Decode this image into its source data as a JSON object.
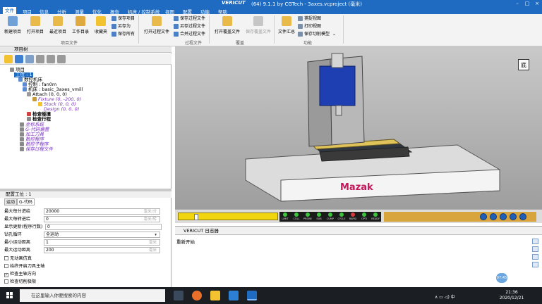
{
  "window": {
    "app_name": "VERICUT",
    "title_suffix": "(64)  9.1.1 by CGTech - 3axes.vcproject (毫米)"
  },
  "menu": [
    "文件",
    "项目",
    "信息",
    "分析",
    "测量",
    "优化",
    "报告",
    "机床 / 控制系统",
    "视图",
    "配置",
    "功能",
    "帮助"
  ],
  "ribbon": {
    "project_file": {
      "buttons": [
        "新建项目",
        "打开项目",
        "最近项目",
        "工作目录",
        "收藏夹"
      ],
      "small": [
        "保存项目",
        "另存为",
        "保存所有"
      ],
      "group": "项目文件"
    },
    "process_file": {
      "button": "打开过程文件",
      "small": [
        "保存过程文件",
        "另存过程文件",
        "合并过程文件"
      ],
      "group": "过程文件"
    },
    "overlay": {
      "buttons": [
        "打开覆盖文件",
        "保存覆盖文件"
      ],
      "group": "覆盖"
    },
    "functions": {
      "button": "文件汇总",
      "small": [
        "捕捉视图",
        "打印视图",
        "保存切削模型"
      ],
      "group": "功能"
    }
  },
  "tree": {
    "title": "项目树",
    "items": [
      "项目",
      "工位 : 1",
      "数控机床",
      "控制 : fan0m",
      "机床 : basic_3axes_vmill",
      "Attach (0, 0, 0)",
      "Fixture (0, -200, 0)",
      "Stock (0, 0, 0)",
      "Design (0, 0, 0)",
      "检查碰撞",
      "检查行程",
      "坐标系统",
      "G-代码偏置",
      "加工刀具",
      "数控程序",
      "数控子程序",
      "保存过程文件"
    ]
  },
  "config": {
    "title": "配置工位 : 1",
    "tabs": [
      "运动",
      "G-代码"
    ],
    "rows": [
      {
        "label": "最大每分进给",
        "value": "20000",
        "unit": "毫米/分"
      },
      {
        "label": "最大每转进给",
        "value": "0",
        "unit": "毫米/转"
      },
      {
        "label": "显示更新(程序行数)",
        "value": "0",
        "unit": ""
      },
      {
        "label": "钻孔循环",
        "value": "全运动",
        "unit": ""
      },
      {
        "label": "最小运动距离",
        "value": "1",
        "unit": "毫米"
      },
      {
        "label": "最大运动距离",
        "value": "200",
        "unit": "毫米"
      }
    ],
    "checks": [
      {
        "label": "无动画仿真",
        "checked": false
      },
      {
        "label": "始终开启刀具主轴",
        "checked": false
      },
      {
        "label": "检查主轴方向",
        "checked": true
      },
      {
        "label": "检查切削极限",
        "checked": false
      }
    ]
  },
  "viewport": {
    "brand": "Mazak",
    "view_cube": "底"
  },
  "status_leds": [
    "LIMIT",
    "COLL",
    "PROBE",
    "SUB",
    "CUMP",
    "CYCLE",
    "RAPID",
    "OPTI",
    "READY"
  ],
  "log": {
    "title": "VERICUT 日志器",
    "text": "重新开始"
  },
  "avatar_text": "07:45",
  "taskbar": {
    "search_placeholder": "在这里输入你要搜索的内容",
    "time": "21:36",
    "date": "2020/12/21",
    "tray": "∧  ▭  ◁)  中"
  },
  "colors": {
    "accent": "#1e6bc1",
    "progress": "#f0d50f"
  }
}
